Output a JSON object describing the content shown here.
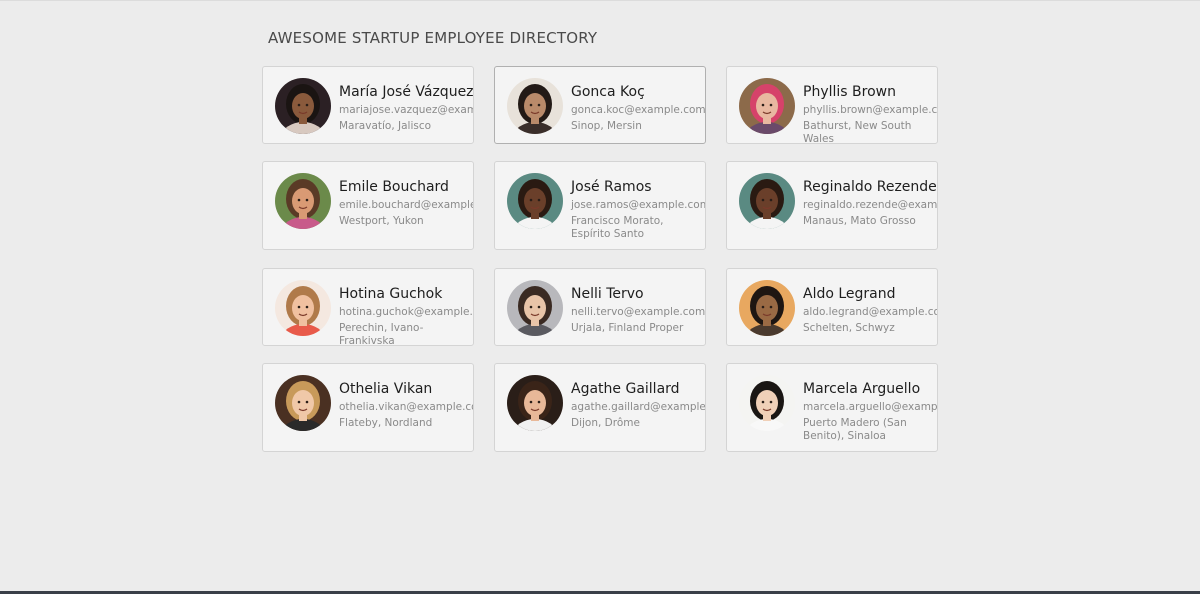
{
  "page": {
    "title": "AWESOME STARTUP EMPLOYEE DIRECTORY"
  },
  "employees": [
    {
      "name": "María José Vázquez",
      "email": "mariajose.vazquez@example.com",
      "location": "Maravatío, Jalisco",
      "skin": "#8a5a3c",
      "hair": "#1a1412",
      "bg": "#2b2024",
      "shirt": "#d8c9c0"
    },
    {
      "name": "Gonca Koç",
      "email": "gonca.koc@example.com",
      "location": "Sinop, Mersin",
      "skin": "#b98a6a",
      "hair": "#231a16",
      "bg": "#e8e2da",
      "shirt": "#3a2e2a"
    },
    {
      "name": "Phyllis Brown",
      "email": "phyllis.brown@example.com",
      "location": "Bathurst, New South Wales",
      "skin": "#e8b8a0",
      "hair": "#d6426a",
      "bg": "#8c6a4a",
      "shirt": "#6a4a6a"
    },
    {
      "name": "Emile Bouchard",
      "email": "emile.bouchard@example.com",
      "location": "Westport, Yukon",
      "skin": "#d99a74",
      "hair": "#5a3a26",
      "bg": "#6b8a4a",
      "shirt": "#c85a8a"
    },
    {
      "name": "José Ramos",
      "email": "jose.ramos@example.com",
      "location": "Francisco Morato, Espírito Santo",
      "skin": "#6a3f2a",
      "hair": "#2a1a12",
      "bg": "#5a8a82",
      "shirt": "#f4f4f4"
    },
    {
      "name": "Reginaldo Rezende",
      "email": "reginaldo.rezende@example.com",
      "location": "Manaus, Mato Grosso",
      "skin": "#6a3f2a",
      "hair": "#2a1a12",
      "bg": "#5a8a82",
      "shirt": "#f4f4f4"
    },
    {
      "name": "Hotina Guchok",
      "email": "hotina.guchok@example.com",
      "location": "Perechin, Ivano-Frankivska",
      "skin": "#f0c0a0",
      "hair": "#b07a4a",
      "bg": "#f4e8e0",
      "shirt": "#e85a4a"
    },
    {
      "name": "Nelli Tervo",
      "email": "nelli.tervo@example.com",
      "location": "Urjala, Finland Proper",
      "skin": "#e8c4a8",
      "hair": "#3a2a22",
      "bg": "#b8b8bc",
      "shirt": "#5a5a60"
    },
    {
      "name": "Aldo Legrand",
      "email": "aldo.legrand@example.com",
      "location": "Schelten, Schwyz",
      "skin": "#9a6a44",
      "hair": "#1e1612",
      "bg": "#e8a860",
      "shirt": "#4a3a2e"
    },
    {
      "name": "Othelia Vikan",
      "email": "othelia.vikan@example.com",
      "location": "Flateby, Nordland",
      "skin": "#f0c8a8",
      "hair": "#c89a5a",
      "bg": "#4a3022",
      "shirt": "#2a2a2a"
    },
    {
      "name": "Agathe Gaillard",
      "email": "agathe.gaillard@example.com",
      "location": "Dijon, Drôme",
      "skin": "#e8b898",
      "hair": "#3a2418",
      "bg": "#2a1e18",
      "shirt": "#f0f0f0"
    },
    {
      "name": "Marcela Arguello",
      "email": "marcela.arguello@example.com",
      "location": "Puerto Madero (San Benito), Sinaloa",
      "skin": "#f0d0b8",
      "hair": "#1a1614",
      "bg": "#f4f4f2",
      "shirt": "#f8f8f8"
    }
  ]
}
